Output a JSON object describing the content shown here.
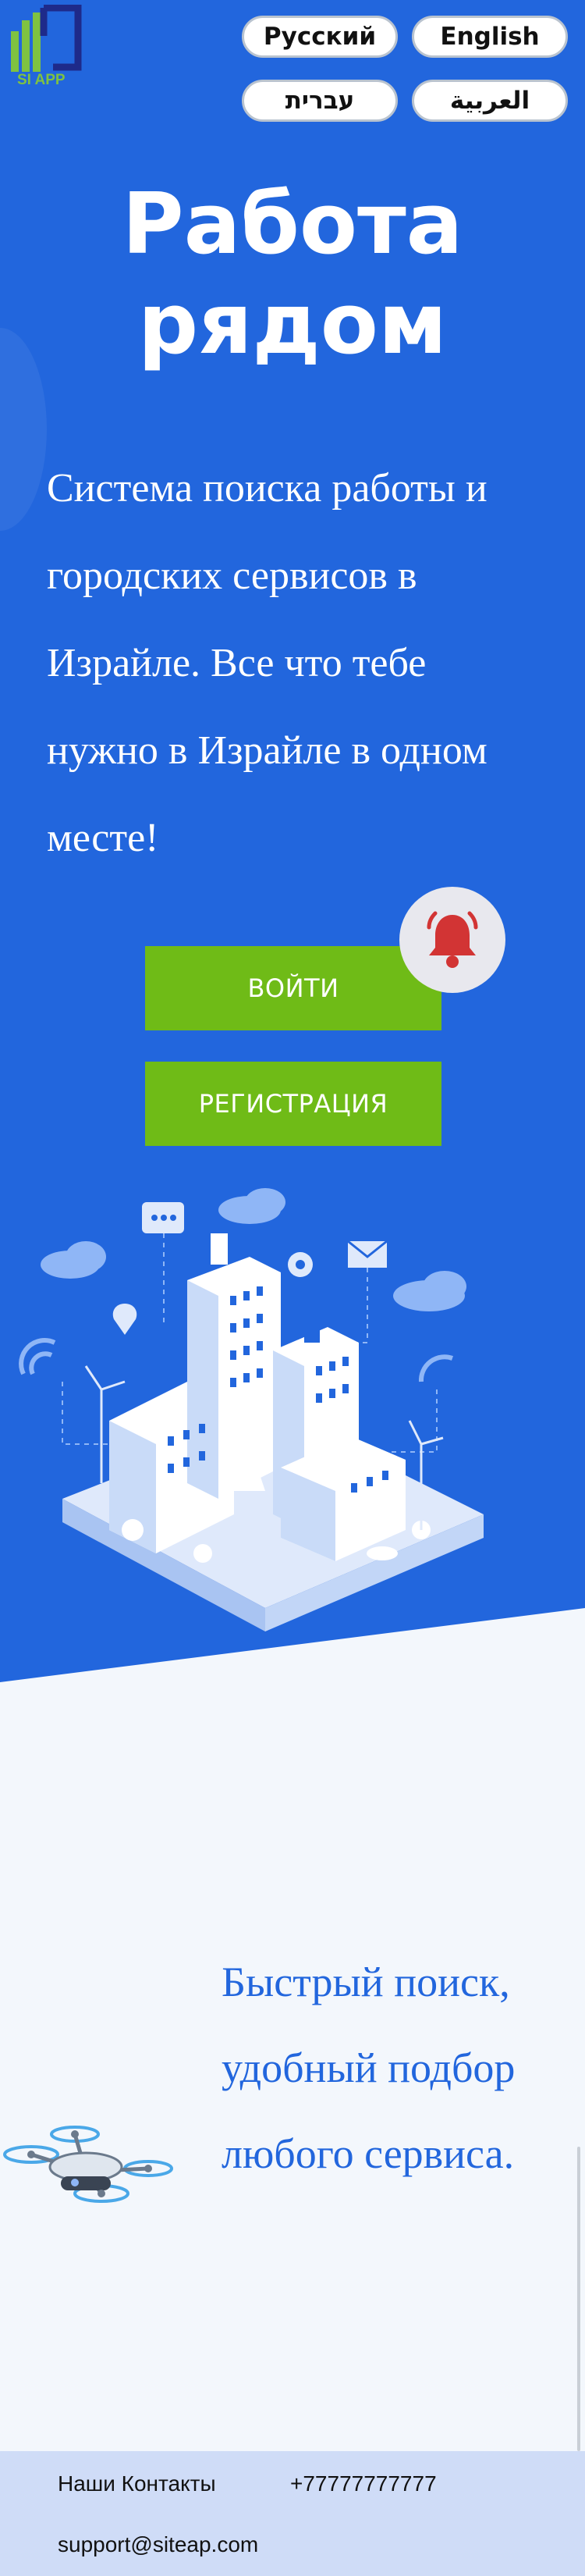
{
  "logo": {
    "text": "SI APP"
  },
  "languages": [
    "Русский",
    "English",
    "עברית",
    "العربية"
  ],
  "hero": {
    "title_line1": "Работа",
    "title_line2": "рядом",
    "subtitle": "Система поиска работы и городских сервисов в Израйле. Все что тебе нужно в Израйле в одном месте!"
  },
  "buttons": {
    "login": "ВОЙТИ",
    "register": "РЕГИСТРАЦИЯ"
  },
  "feature": {
    "text": "Быстрый поиск, удобный подбор любого сервиса."
  },
  "footer": {
    "contacts_label": "Наши Контакты",
    "phone": "+77777777777",
    "email": "support@siteap.com"
  },
  "colors": {
    "hero_bg": "#2266dd",
    "cta": "#6fbb17",
    "footer_bg": "#cfdcf7",
    "feature_text": "#2266dd"
  },
  "icons": [
    "logo-icon",
    "bell-icon",
    "city-illustration",
    "drone-illustration"
  ]
}
